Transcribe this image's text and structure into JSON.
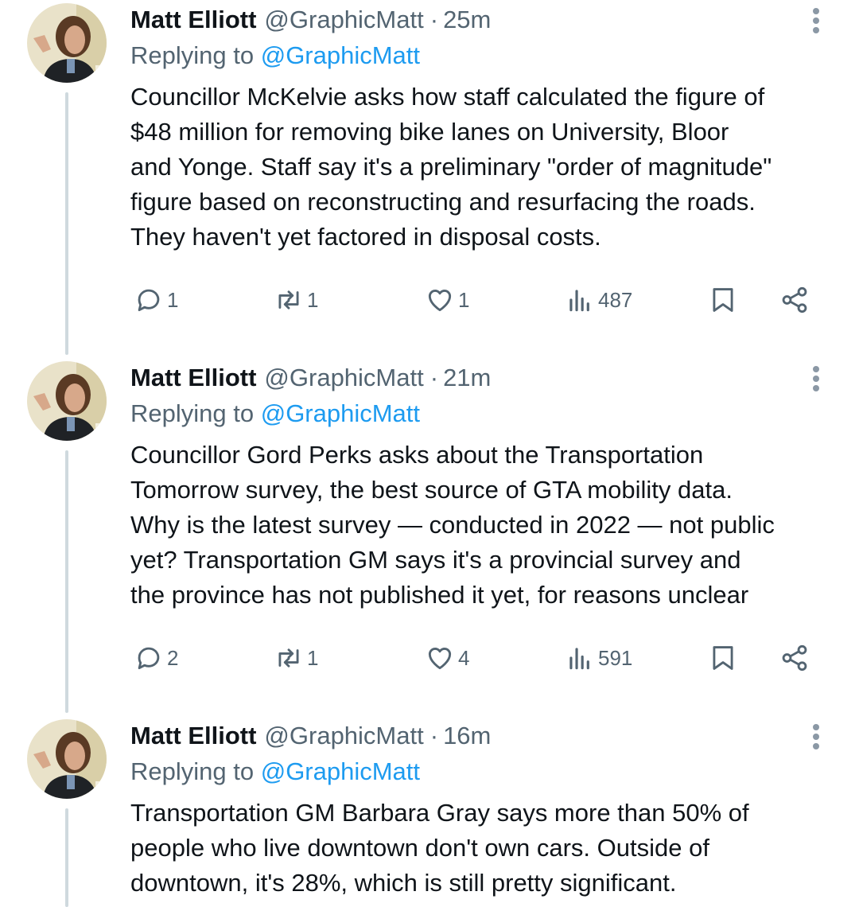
{
  "colors": {
    "accent": "#1d9bf0",
    "muted": "#536471",
    "text": "#0f1419",
    "thread": "#cfd9de"
  },
  "tweets": [
    {
      "author": "Matt Elliott",
      "handle": "@GraphicMatt",
      "separator": "·",
      "time": "25m",
      "replying_prefix": "Replying to ",
      "replying_to": "@GraphicMatt",
      "lines": [
        "Councillor McKelvie asks how staff calculated the figure of",
        "$48 million for removing bike lanes on University, Bloor",
        "and Yonge. Staff say it's a preliminary \"order of magnitude\"",
        "figure based on reconstructing and resurfacing the roads.",
        "They haven't yet factored in disposal costs."
      ],
      "replies": "1",
      "reposts": "1",
      "likes": "1",
      "views": "487"
    },
    {
      "author": "Matt Elliott",
      "handle": "@GraphicMatt",
      "separator": "·",
      "time": "21m",
      "replying_prefix": "Replying to ",
      "replying_to": "@GraphicMatt",
      "lines": [
        "Councillor Gord Perks asks about the Transportation",
        "Tomorrow survey, the best source of GTA mobility data.",
        "Why is the latest survey — conducted in 2022 — not public",
        "yet? Transportation GM says it's a provincial survey and",
        "the province has not published it yet, for reasons unclear"
      ],
      "replies": "2",
      "reposts": "1",
      "likes": "4",
      "views": "591"
    },
    {
      "author": "Matt Elliott",
      "handle": "@GraphicMatt",
      "separator": "·",
      "time": "16m",
      "replying_prefix": "Replying to ",
      "replying_to": "@GraphicMatt",
      "lines": [
        "Transportation GM Barbara Gray says more than 50% of",
        "people who live downtown don't own cars. Outside of",
        "downtown, it's 28%, which is still pretty significant."
      ]
    }
  ],
  "icons": {
    "reply": "reply-icon",
    "repost": "repost-icon",
    "like": "heart-icon",
    "views": "views-icon",
    "bookmark": "bookmark-icon",
    "share": "share-icon",
    "more": "more-icon"
  }
}
